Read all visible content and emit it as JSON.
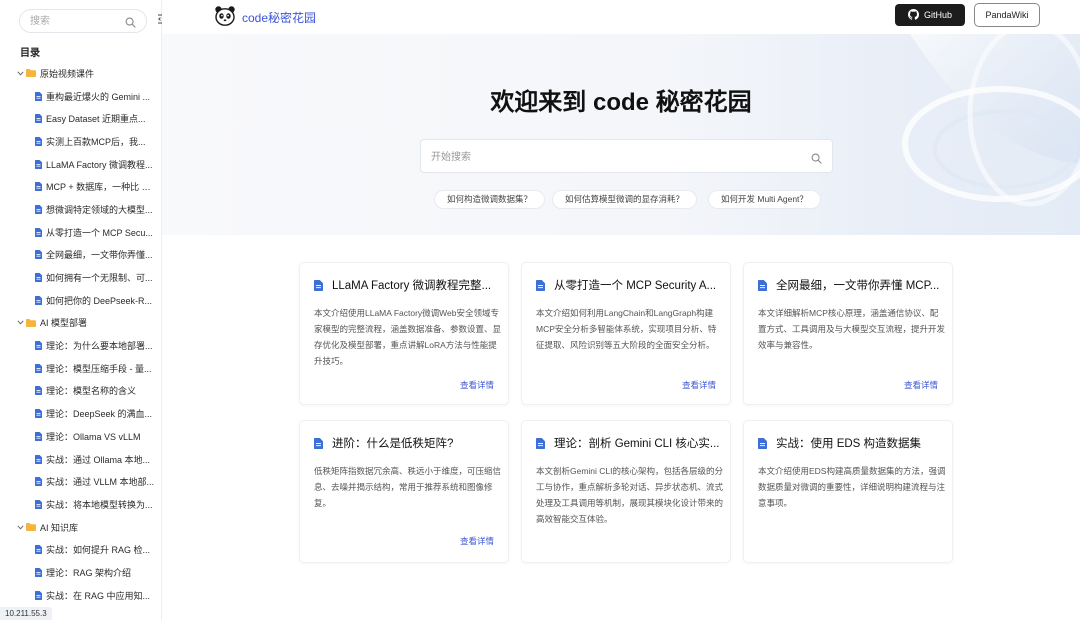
{
  "sidebar": {
    "search_placeholder": "搜索",
    "toc_title": "目录",
    "tree": [
      {
        "type": "folder",
        "label": "原始视频课件"
      },
      {
        "type": "doc",
        "label": "重构最近爆火的 Gemini ..."
      },
      {
        "type": "doc",
        "label": "Easy Dataset 近期重点..."
      },
      {
        "type": "doc",
        "label": "实测上百款MCP后，我..."
      },
      {
        "type": "doc",
        "label": "LLaMA Factory 微调教程..."
      },
      {
        "type": "doc",
        "label": "MCP + 数据库，一种比 R..."
      },
      {
        "type": "doc",
        "label": "想微调特定领域的大模型..."
      },
      {
        "type": "doc",
        "label": "从零打造一个 MCP Secu..."
      },
      {
        "type": "doc",
        "label": "全网最细，一文带你弄懂..."
      },
      {
        "type": "doc",
        "label": "如何拥有一个无限制、可..."
      },
      {
        "type": "doc",
        "label": "如何把你的 DeePseek-R..."
      },
      {
        "type": "folder",
        "label": "AI 模型部署"
      },
      {
        "type": "doc",
        "label": "理论：为什么要本地部署..."
      },
      {
        "type": "doc",
        "label": "理论：模型压缩手段 - 量..."
      },
      {
        "type": "doc",
        "label": "理论：模型名称的含义"
      },
      {
        "type": "doc",
        "label": "理论：DeepSeek 的满血..."
      },
      {
        "type": "doc",
        "label": "理论：Ollama VS vLLM"
      },
      {
        "type": "doc",
        "label": "实战：通过 Ollama 本地..."
      },
      {
        "type": "doc",
        "label": "实战：通过 VLLM 本地部..."
      },
      {
        "type": "doc",
        "label": "实战：将本地模型转换为..."
      },
      {
        "type": "folder",
        "label": "AI 知识库"
      },
      {
        "type": "doc",
        "label": "实战：如何提升 RAG 检..."
      },
      {
        "type": "doc",
        "label": "理论：RAG 架构介绍"
      },
      {
        "type": "doc",
        "label": "实战：在 RAG 中应用知..."
      }
    ],
    "ip": "10.211.55.3"
  },
  "header": {
    "brand": "code秘密花园",
    "github_label": "GitHub",
    "pandawiki_label": "PandaWiki"
  },
  "hero": {
    "title": "欢迎来到 code 秘密花园",
    "search_placeholder": "开始搜索",
    "hints": [
      "如何构造微调数据集？",
      "如何估算模型微调的显存消耗？",
      "如何开发 Multi Agent？"
    ]
  },
  "cards": [
    {
      "title": "LLaMA Factory 微调教程完整...",
      "desc": "本文介绍使用LLaMA Factory微调Web安全领域专家模型的完整流程，涵盖数据准备、参数设置、显存优化及模型部署，重点讲解LoRA方法与性能提升技巧。",
      "more": "查看详情"
    },
    {
      "title": "从零打造一个 MCP Security A...",
      "desc": "本文介绍如何利用LangChain和LangGraph构建MCP安全分析多智能体系统，实现项目分析、特征提取、风险识别等五大阶段的全面安全分析。",
      "more": "查看详情"
    },
    {
      "title": "全网最细，一文带你弄懂 MCP...",
      "desc": "本文详细解析MCP核心原理，涵盖通信协议、配置方式、工具调用及与大模型交互流程，提升开发效率与兼容性。",
      "more": "查看详情"
    },
    {
      "title": "进阶：什么是低秩矩阵?",
      "desc": "低秩矩阵指数据冗余高、秩远小于维度，可压缩信息、去噪并揭示结构，常用于推荐系统和图像修复。",
      "more": "查看详情"
    },
    {
      "title": "理论：剖析 Gemini CLI 核心实...",
      "desc": "本文剖析Gemini CLI的核心架构，包括各层级的分工与协作，重点解析多轮对话、异步状态机、流式处理及工具调用等机制，展现其模块化设计带来的高效智能交互体验。",
      "more": ""
    },
    {
      "title": "实战：使用 EDS 构造数据集",
      "desc": "本文介绍使用EDS构建高质量数据集的方法，强调数据质量对微调的重要性，详细说明构建流程与注意事项。",
      "more": ""
    }
  ],
  "colors": {
    "accent": "#3b55d6",
    "github_bg": "#1c1c1c",
    "folder": "#f5b43c",
    "doc": "#3d6fd8"
  }
}
